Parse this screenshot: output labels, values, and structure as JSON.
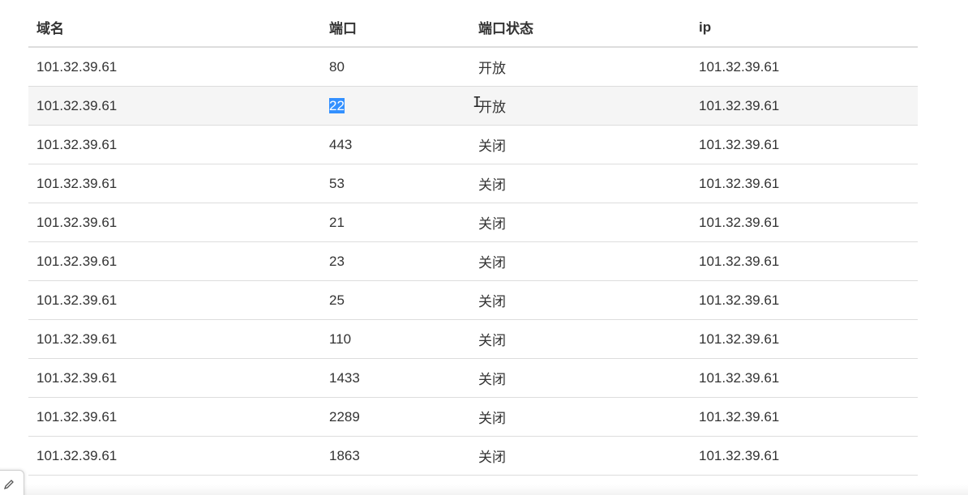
{
  "table": {
    "headers": {
      "domain": "域名",
      "port": "端口",
      "status": "端口状态",
      "ip": "ip"
    },
    "rows": [
      {
        "domain": "101.32.39.61",
        "port": "80",
        "status": "开放",
        "ip": "101.32.39.61"
      },
      {
        "domain": "101.32.39.61",
        "port": "22",
        "status": "开放",
        "ip": "101.32.39.61"
      },
      {
        "domain": "101.32.39.61",
        "port": "443",
        "status": "关闭",
        "ip": "101.32.39.61"
      },
      {
        "domain": "101.32.39.61",
        "port": "53",
        "status": "关闭",
        "ip": "101.32.39.61"
      },
      {
        "domain": "101.32.39.61",
        "port": "21",
        "status": "关闭",
        "ip": "101.32.39.61"
      },
      {
        "domain": "101.32.39.61",
        "port": "23",
        "status": "关闭",
        "ip": "101.32.39.61"
      },
      {
        "domain": "101.32.39.61",
        "port": "25",
        "status": "关闭",
        "ip": "101.32.39.61"
      },
      {
        "domain": "101.32.39.61",
        "port": "110",
        "status": "关闭",
        "ip": "101.32.39.61"
      },
      {
        "domain": "101.32.39.61",
        "port": "1433",
        "status": "关闭",
        "ip": "101.32.39.61"
      },
      {
        "domain": "101.32.39.61",
        "port": "2289",
        "status": "关闭",
        "ip": "101.32.39.61"
      },
      {
        "domain": "101.32.39.61",
        "port": "1863",
        "status": "关闭",
        "ip": "101.32.39.61"
      }
    ]
  },
  "cursor": {
    "glyph": "I"
  },
  "colors": {
    "open_status": "#b5432a",
    "selection": "#3390ff",
    "hover_row": "#f5f5f5",
    "border": "#dddddd"
  },
  "icons": {
    "corner_widget": "pencil-icon"
  }
}
